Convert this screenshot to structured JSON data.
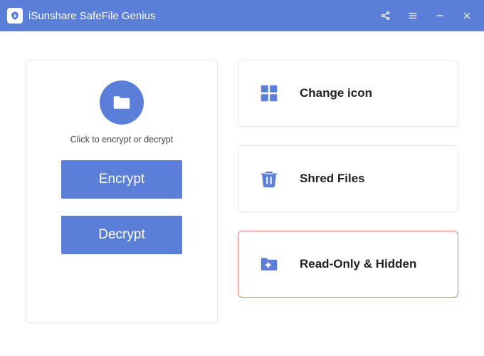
{
  "app": {
    "title": "iSunshare SafeFile Genius"
  },
  "left": {
    "hint": "Click to encrypt or decrypt",
    "encrypt_label": "Encrypt",
    "decrypt_label": "Decrypt"
  },
  "features": {
    "change_icon": "Change icon",
    "shred_files": "Shred Files",
    "readonly_hidden": "Read-Only & Hidden"
  },
  "colors": {
    "primary": "#5b7ed8",
    "highlight_border": "#ea7b7b"
  }
}
